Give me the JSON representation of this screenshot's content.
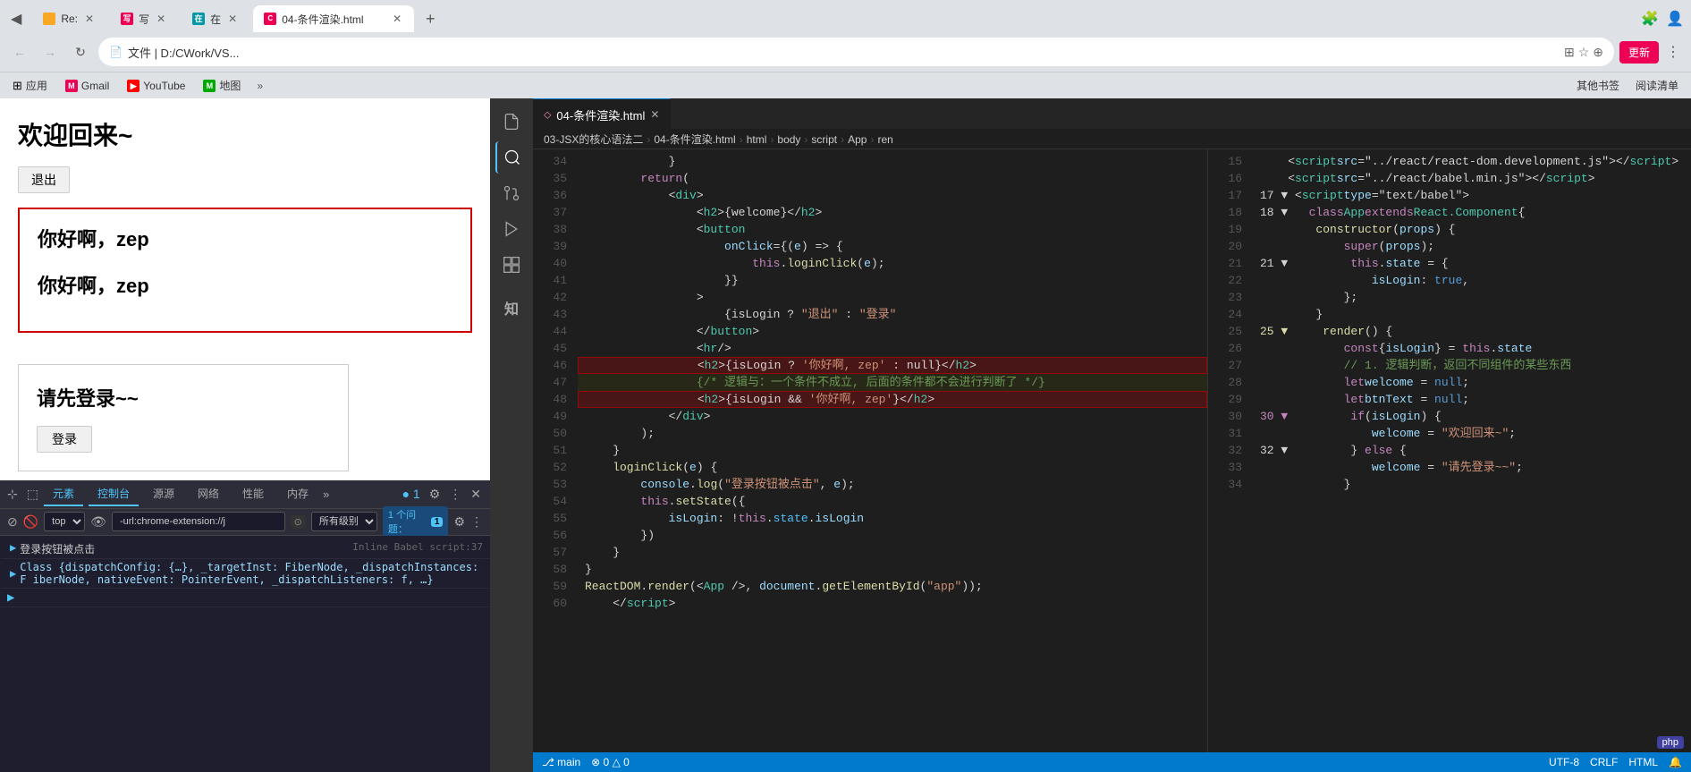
{
  "browser": {
    "tab_label": "Re:",
    "tab2_label": "写",
    "tab3_label": "在",
    "tab4_label": "04-条件渲染.html",
    "address": "文件 | D:/CWork/VS...",
    "update_btn": "更新",
    "bookmarks": [
      "应用",
      "Gmail",
      "YouTube",
      "地图"
    ],
    "bookmark_more": "»",
    "bookmarks_right": [
      "其他书签",
      "阅读清单"
    ]
  },
  "browser_page": {
    "welcome": "欢迎回来~",
    "logout_btn": "退出",
    "hello_text1": "你好啊，zep",
    "hello_text2": "你好啊，zep",
    "login_title": "请先登录~~",
    "login_btn": "登录"
  },
  "devtools": {
    "tabs": [
      "元素",
      "控制台",
      "源源",
      "网络",
      "性能",
      "内存"
    ],
    "active_tab": "控制台",
    "position_dropdown": "top",
    "filter_placeholder": "-url:chrome-extension://j",
    "level_dropdown": "所有级别",
    "issue_label": "1 个问题：",
    "issue_count": "1",
    "console_lines": [
      {
        "type": "log",
        "content": "登录按钮被点击",
        "source": "Inline Babel script:37"
      },
      {
        "type": "obj",
        "content": "Class {dispatchConfig: {…}, _targetInst: FiberNode, _dispatchInstances: F iberNode, nativeEvent: PointerEvent, _dispatchListeners: f, …}",
        "expandable": true
      }
    ]
  },
  "vscode": {
    "tab_label": "04-条件渲染.html",
    "breadcrumbs": [
      "03-JSX的核心语法二",
      "04-条件渲染.html",
      "html",
      "body",
      "script",
      "App",
      "ren"
    ],
    "lines": {
      "start": 34,
      "end": 60
    }
  },
  "vscode_right": {
    "line_start": 15,
    "line_end": 34
  },
  "colors": {
    "accent_blue": "#007acc",
    "highlight_red_border": "#c00000",
    "vscode_bg": "#1e1e1e",
    "sidebar_bg": "#333333"
  }
}
